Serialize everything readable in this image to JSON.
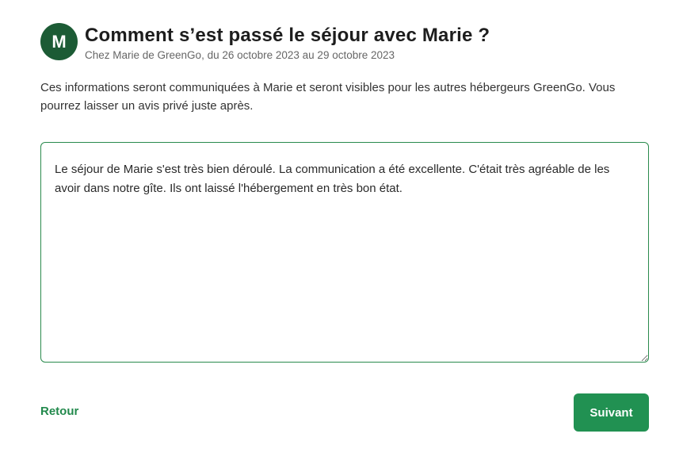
{
  "host": {
    "avatar_initial": "M",
    "avatar_color": "#1c5b35"
  },
  "header": {
    "title": "Comment s’est passé le séjour avec Marie ?",
    "subtitle": "Chez Marie de GreenGo, du 26 octobre 2023 au 29 octobre 2023"
  },
  "info": {
    "text": "Ces informations seront communiquées à Marie et seront visibles pour les autres hébergeurs GreenGo. Vous pourrez laisser un avis privé juste après."
  },
  "review": {
    "value": "Le séjour de Marie s'est très bien déroulé. La communication a été excellente. C'était très agréable de les avoir dans notre gîte. Ils ont laissé l'hébergement en très bon état."
  },
  "actions": {
    "back_label": "Retour",
    "next_label": "Suivant"
  },
  "colors": {
    "accent": "#219152",
    "border": "#2a8a4d"
  }
}
